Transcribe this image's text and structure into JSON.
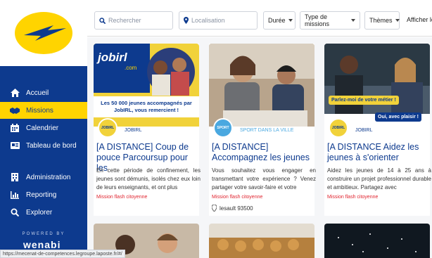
{
  "sidebar": {
    "items": [
      {
        "label": "Accueil",
        "icon": "home-icon"
      },
      {
        "label": "Missions",
        "icon": "handshake-icon"
      },
      {
        "label": "Calendrier",
        "icon": "calendar-icon"
      },
      {
        "label": "Tableau de bord",
        "icon": "dashboard-icon"
      },
      {
        "label": "Administration",
        "icon": "building-icon"
      },
      {
        "label": "Reporting",
        "icon": "bar-chart-icon"
      },
      {
        "label": "Explorer",
        "icon": "search-icon"
      }
    ],
    "powered_by": "POWERED BY",
    "brand": "wenabi"
  },
  "topbar": {
    "search_placeholder": "Rechercher",
    "location_placeholder": "Localisation",
    "filters": [
      "Durée",
      "Type de missions",
      "Thèmes"
    ],
    "display_label": "Afficher le"
  },
  "cards": [
    {
      "banner_brand": "jobirl",
      "banner_sub": ".com",
      "banner_caption": "Les 50 000 jeunes accompagnés par JobIRL, vous remercient !",
      "org": "JOBIRL",
      "title": "[A DISTANCE] Coup de pouce Parcoursup pour les",
      "description": "En cette période de confinement, les jeunes sont démunis, isolés chez eux loin de leurs enseignants, et ont plus",
      "tag": "Mission flash citoyenne",
      "location": ""
    },
    {
      "org": "SPORT DANS LA VILLE",
      "org_badge": "SPORT",
      "title": "[A DISTANCE] Accompagnez les jeunes",
      "description": "Vous souhaitez vous engager en transmettant votre expérience ? Venez partager votre savoir-faire et votre",
      "tag": "Mission flash citoyenne",
      "location": "lesault 93500"
    },
    {
      "bubble1": "Parlez-moi de votre métier !",
      "bubble2": "Oui, avec plaisir !",
      "org": "JOBIRL",
      "title": "[A DISTANCE Aidez les jeunes à s'orienter",
      "description": "Aidez les jeunes de 14 à 25 ans à construire un projet professionnel durable et ambitieux. Partagez avec",
      "tag": "Mission flash citoyenne",
      "location": ""
    }
  ],
  "status_url": "https://mecenat-de-competences.legroupe.laposte.fr/#/",
  "colors": {
    "brand_blue": "#0d3a8e",
    "brand_yellow": "#ffd400",
    "tag_red": "#e0242f"
  }
}
